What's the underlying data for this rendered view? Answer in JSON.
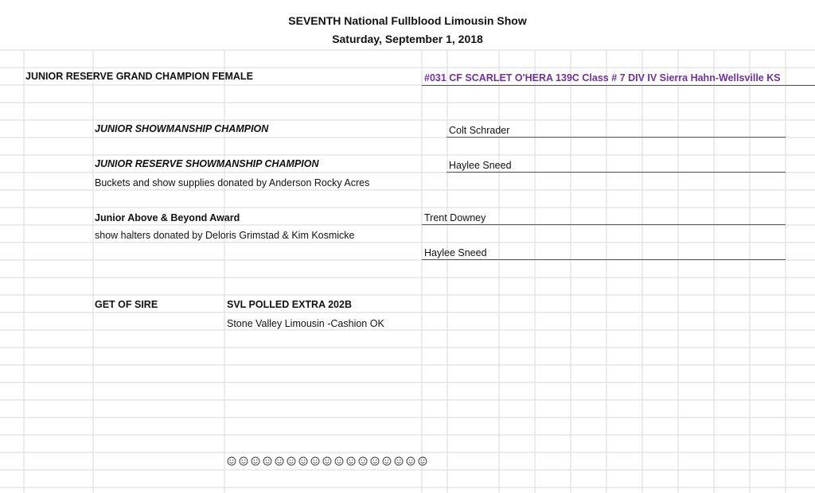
{
  "header": {
    "title": "SEVENTH  National Fullblood Limousin Show",
    "date": "Saturday, September 1, 2018"
  },
  "awards": {
    "junior_reserve_grand_champion_female": {
      "label": "JUNIOR RESERVE GRAND CHAMPION FEMALE",
      "winner": "#031 CF SCARLET O'HERA 139C Class # 7 DIV IV  Sierra Hahn-Wellsville KS"
    },
    "junior_showmanship_champion": {
      "label": "JUNIOR SHOWMANSHIP CHAMPION",
      "winner": "Colt Schrader"
    },
    "junior_reserve_showmanship_champion": {
      "label": "JUNIOR RESERVE SHOWMANSHIP CHAMPION",
      "winner": "Haylee Sneed",
      "note": "Buckets and show supplies donated by Anderson Rocky Acres"
    },
    "junior_above_beyond": {
      "label": "Junior Above & Beyond Award",
      "winner_1": "Trent Downey",
      "note": "show halters donated by Deloris Grimstad & Kim Kosmicke",
      "winner_2": "Haylee Sneed"
    },
    "get_of_sire": {
      "label": "GET OF SIRE",
      "sire": "SVL POLLED EXTRA 202B",
      "owner": "Stone Valley Limousin -Cashion OK"
    }
  },
  "decorations": {
    "smiley_count": 17,
    "smiley_icon": "smiley-face-icon",
    "accent_color": "#7030a0"
  }
}
